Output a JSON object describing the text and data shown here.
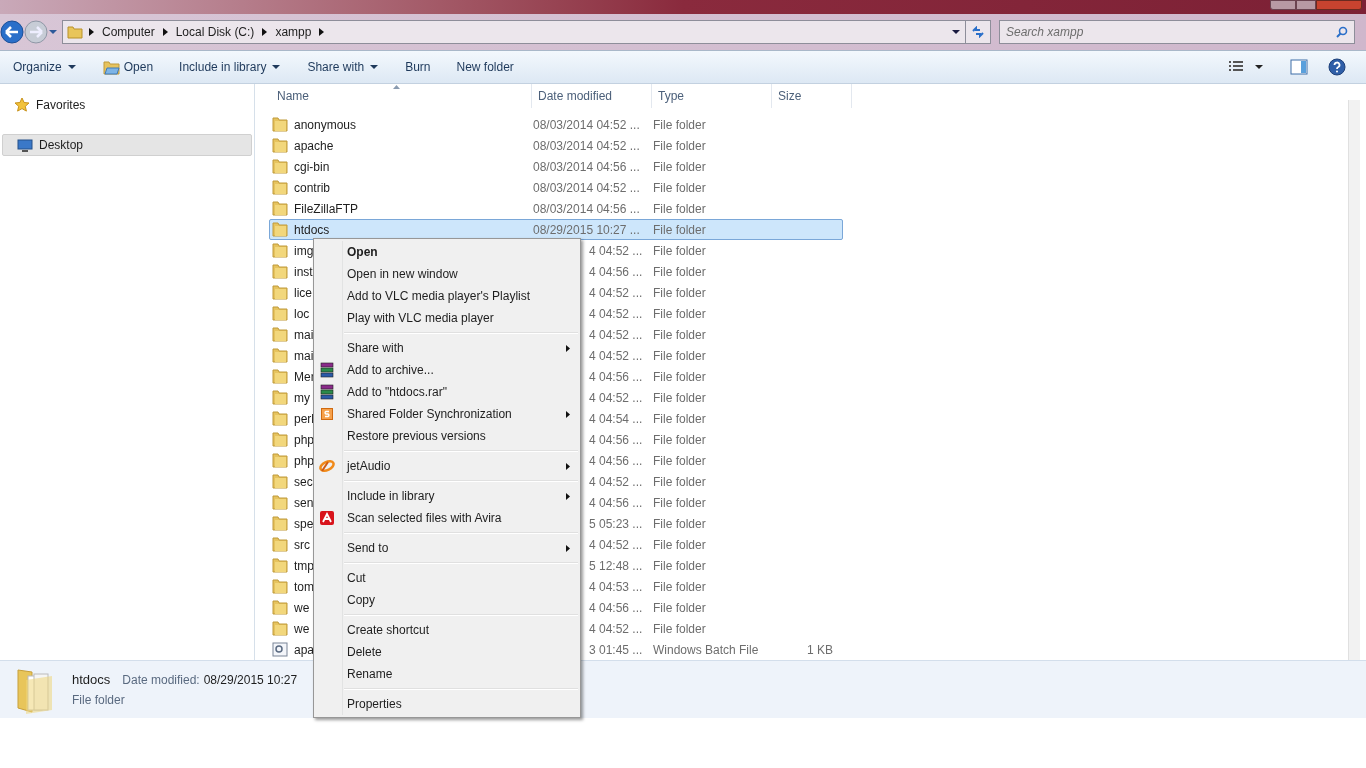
{
  "breadcrumb": [
    "Computer",
    "Local Disk (C:)",
    "xampp"
  ],
  "search": {
    "placeholder": "Search xampp"
  },
  "toolbar": [
    {
      "label": "Organize",
      "dropdown": true,
      "icon": false
    },
    {
      "label": "Open",
      "dropdown": false,
      "icon": true
    },
    {
      "label": "Include in library",
      "dropdown": true,
      "icon": false
    },
    {
      "label": "Share with",
      "dropdown": true,
      "icon": false
    },
    {
      "label": "Burn",
      "dropdown": false,
      "icon": false
    },
    {
      "label": "New folder",
      "dropdown": false,
      "icon": false
    }
  ],
  "sidebar": {
    "items": [
      {
        "label": "Favorites",
        "kind": "favorites",
        "selected": false
      },
      {
        "label": "Desktop",
        "kind": "desktop",
        "selected": true
      }
    ]
  },
  "table": {
    "columns": [
      "Name",
      "Date modified",
      "Type",
      "Size"
    ],
    "rows": [
      {
        "name": "anonymous",
        "date": "08/03/2014 04:52 ...",
        "type": "File folder",
        "kind": "folder",
        "selected": false,
        "covered": false
      },
      {
        "name": "apache",
        "date": "08/03/2014 04:52 ...",
        "type": "File folder",
        "kind": "folder",
        "selected": false,
        "covered": false
      },
      {
        "name": "cgi-bin",
        "date": "08/03/2014 04:56 ...",
        "type": "File folder",
        "kind": "folder",
        "selected": false,
        "covered": false
      },
      {
        "name": "contrib",
        "date": "08/03/2014 04:52 ...",
        "type": "File folder",
        "kind": "folder",
        "selected": false,
        "covered": false
      },
      {
        "name": "FileZillaFTP",
        "date": "08/03/2014 04:56 ...",
        "type": "File folder",
        "kind": "folder",
        "selected": false,
        "covered": false
      },
      {
        "name": "htdocs",
        "date": "08/29/2015 10:27 ...",
        "type": "File folder",
        "kind": "folder",
        "selected": true,
        "covered": false
      },
      {
        "name": "img",
        "date": "4 04:52 ...",
        "type": "File folder",
        "kind": "folder",
        "selected": false,
        "covered": true
      },
      {
        "name": "inst",
        "date": "4 04:56 ...",
        "type": "File folder",
        "kind": "folder",
        "selected": false,
        "covered": true
      },
      {
        "name": "lice",
        "date": "4 04:52 ...",
        "type": "File folder",
        "kind": "folder",
        "selected": false,
        "covered": true
      },
      {
        "name": "loc",
        "date": "4 04:52 ...",
        "type": "File folder",
        "kind": "folder",
        "selected": false,
        "covered": true
      },
      {
        "name": "mai",
        "date": "4 04:52 ...",
        "type": "File folder",
        "kind": "folder",
        "selected": false,
        "covered": true
      },
      {
        "name": "mai",
        "date": "4 04:52 ...",
        "type": "File folder",
        "kind": "folder",
        "selected": false,
        "covered": true
      },
      {
        "name": "Mer",
        "date": "4 04:56 ...",
        "type": "File folder",
        "kind": "folder",
        "selected": false,
        "covered": true
      },
      {
        "name": "my",
        "date": "4 04:52 ...",
        "type": "File folder",
        "kind": "folder",
        "selected": false,
        "covered": true
      },
      {
        "name": "perl",
        "date": "4 04:54 ...",
        "type": "File folder",
        "kind": "folder",
        "selected": false,
        "covered": true
      },
      {
        "name": "php",
        "date": "4 04:56 ...",
        "type": "File folder",
        "kind": "folder",
        "selected": false,
        "covered": true
      },
      {
        "name": "php",
        "date": "4 04:56 ...",
        "type": "File folder",
        "kind": "folder",
        "selected": false,
        "covered": true
      },
      {
        "name": "sec",
        "date": "4 04:52 ...",
        "type": "File folder",
        "kind": "folder",
        "selected": false,
        "covered": true
      },
      {
        "name": "sen",
        "date": "4 04:56 ...",
        "type": "File folder",
        "kind": "folder",
        "selected": false,
        "covered": true
      },
      {
        "name": "spe",
        "date": "5 05:23 ...",
        "type": "File folder",
        "kind": "folder",
        "selected": false,
        "covered": true
      },
      {
        "name": "src",
        "date": "4 04:52 ...",
        "type": "File folder",
        "kind": "folder",
        "selected": false,
        "covered": true
      },
      {
        "name": "tmp",
        "date": "5 12:48 ...",
        "type": "File folder",
        "kind": "folder",
        "selected": false,
        "covered": true
      },
      {
        "name": "tom",
        "date": "4 04:53 ...",
        "type": "File folder",
        "kind": "folder",
        "selected": false,
        "covered": true
      },
      {
        "name": "we",
        "date": "4 04:56 ...",
        "type": "File folder",
        "kind": "folder",
        "selected": false,
        "covered": true
      },
      {
        "name": "we",
        "date": "4 04:52 ...",
        "type": "File folder",
        "kind": "folder",
        "selected": false,
        "covered": true
      },
      {
        "name": "apa",
        "date": "3 01:45 ...",
        "type": "Windows Batch File",
        "size": "1 KB",
        "kind": "batch",
        "selected": false,
        "covered": true
      }
    ]
  },
  "details": {
    "name": "htdocs",
    "date_label": "Date modified:",
    "date": "08/29/2015 10:27",
    "type": "File folder"
  },
  "context_menu": [
    {
      "kind": "item",
      "label": "Open",
      "bold": true
    },
    {
      "kind": "item",
      "label": "Open in new window"
    },
    {
      "kind": "item",
      "label": "Add to VLC media player's Playlist"
    },
    {
      "kind": "item",
      "label": "Play with VLC media player"
    },
    {
      "kind": "separator"
    },
    {
      "kind": "item",
      "label": "Share with",
      "submenu": true
    },
    {
      "kind": "archive",
      "label": "Add to archive..."
    },
    {
      "kind": "archive",
      "label": "Add to \"htdocs.rar\""
    },
    {
      "kind": "sync",
      "label": "Shared Folder Synchronization",
      "submenu": true
    },
    {
      "kind": "item",
      "label": "Restore previous versions"
    },
    {
      "kind": "separator"
    },
    {
      "kind": "audio",
      "label": "jetAudio",
      "submenu": true
    },
    {
      "kind": "separator"
    },
    {
      "kind": "item",
      "label": "Include in library",
      "submenu": true
    },
    {
      "kind": "scan",
      "label": "Scan selected files with Avira"
    },
    {
      "kind": "separator"
    },
    {
      "kind": "item",
      "label": "Send to",
      "submenu": true
    },
    {
      "kind": "separator"
    },
    {
      "kind": "item",
      "label": "Cut"
    },
    {
      "kind": "item",
      "label": "Copy"
    },
    {
      "kind": "separator"
    },
    {
      "kind": "item",
      "label": "Create shortcut"
    },
    {
      "kind": "item",
      "label": "Delete"
    },
    {
      "kind": "item",
      "label": "Rename"
    },
    {
      "kind": "separator"
    },
    {
      "kind": "item",
      "label": "Properties"
    }
  ]
}
